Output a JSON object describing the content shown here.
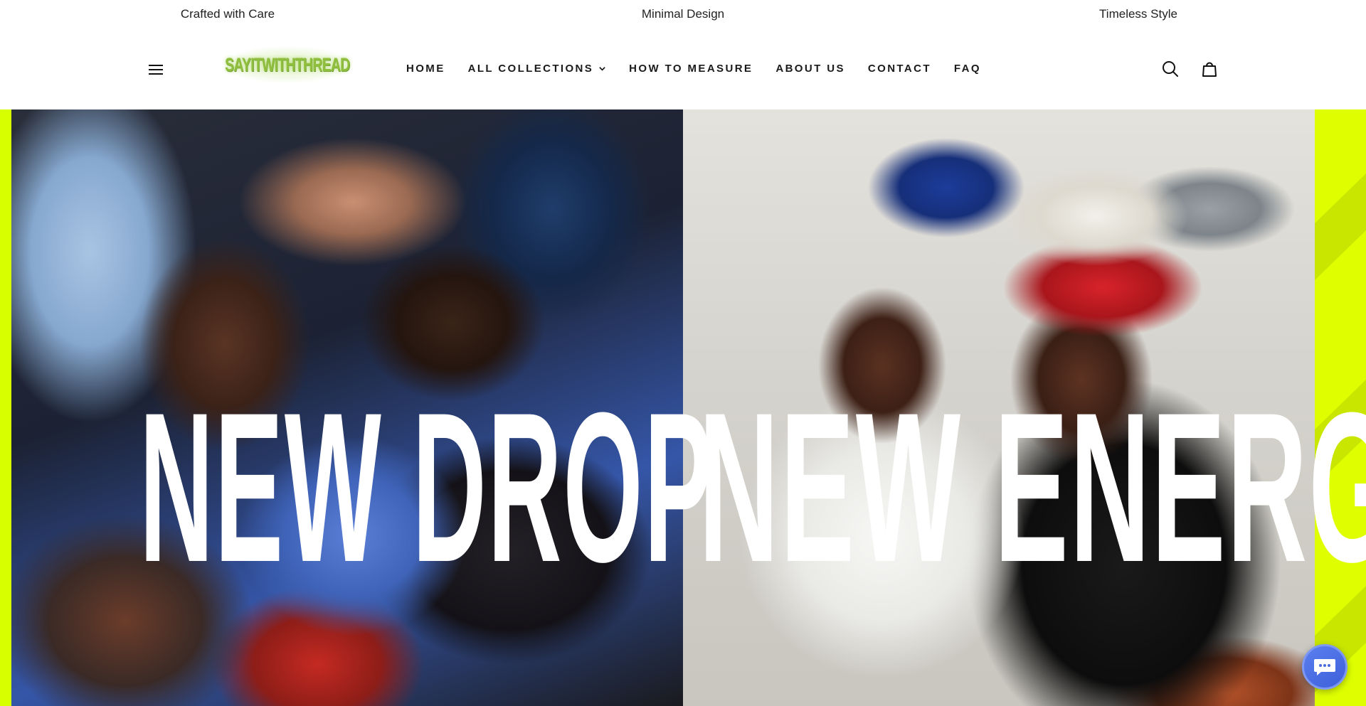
{
  "announcement": {
    "items": [
      "Crafted with Care",
      "Minimal Design",
      "Timeless Style"
    ]
  },
  "header": {
    "logo_text": "SAYITWITHTHREAD",
    "nav": [
      {
        "label": "HOME",
        "has_dropdown": false
      },
      {
        "label": "ALL COLLECTIONS",
        "has_dropdown": true
      },
      {
        "label": "HOW TO MEASURE",
        "has_dropdown": false
      },
      {
        "label": "ABOUT US",
        "has_dropdown": false
      },
      {
        "label": "CONTACT",
        "has_dropdown": false
      },
      {
        "label": "FAQ",
        "has_dropdown": false
      }
    ],
    "icons": {
      "menu": "hamburger-menu-icon",
      "search": "search-icon",
      "cart": "shopping-bag-icon"
    }
  },
  "hero": {
    "headline_left": "NEW DROP",
    "headline_right": "NEW ENERGY",
    "accent_color": "#dfff00",
    "headline_color": "#ffffff"
  },
  "chat": {
    "icon": "chat-bubble-icon",
    "color": "#4a6be0"
  }
}
